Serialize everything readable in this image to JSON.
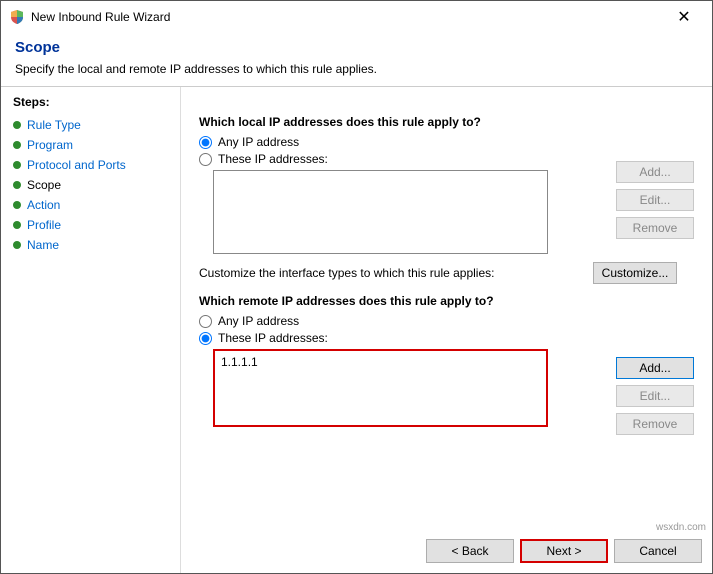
{
  "window": {
    "title": "New Inbound Rule Wizard"
  },
  "header": {
    "title": "Scope",
    "subtitle": "Specify the local and remote IP addresses to which this rule applies."
  },
  "steps": {
    "label": "Steps:",
    "items": [
      {
        "label": "Rule Type"
      },
      {
        "label": "Program"
      },
      {
        "label": "Protocol and Ports"
      },
      {
        "label": "Scope"
      },
      {
        "label": "Action"
      },
      {
        "label": "Profile"
      },
      {
        "label": "Name"
      }
    ]
  },
  "main": {
    "local": {
      "question": "Which local IP addresses does this rule apply to?",
      "opt_any": "Any IP address",
      "opt_these": "These IP addresses:"
    },
    "customize_text": "Customize the interface types to which this rule applies:",
    "customize_btn": "Customize...",
    "remote": {
      "question": "Which remote IP addresses does this rule apply to?",
      "opt_any": "Any IP address",
      "opt_these": "These IP addresses:",
      "entries": [
        "1.1.1.1"
      ]
    },
    "btns": {
      "add": "Add...",
      "edit": "Edit...",
      "remove": "Remove"
    }
  },
  "footer": {
    "back": "< Back",
    "next": "Next >",
    "cancel": "Cancel"
  },
  "watermark": "wsxdn.com"
}
